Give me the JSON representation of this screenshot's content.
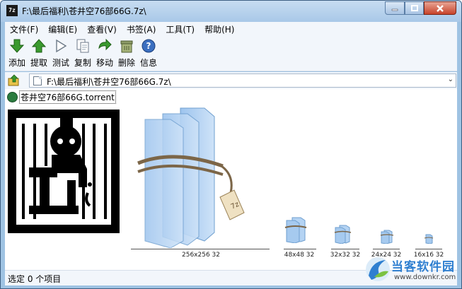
{
  "window": {
    "title": "F:\\最后福利\\苍井空76部66G.7z\\",
    "app_icon": "7z"
  },
  "menu": [
    "文件(F)",
    "编辑(E)",
    "查看(V)",
    "书签(A)",
    "工具(T)",
    "帮助(H)"
  ],
  "toolbar": [
    "添加",
    "提取",
    "测试",
    "复制",
    "移动",
    "删除",
    "信息"
  ],
  "address": {
    "path": "F:\\最后福利\\苍井空76部66G.7z\\"
  },
  "file": {
    "name": "苍井空76部66G.torrent"
  },
  "preview_sizes": [
    "256x256 32",
    "48x48 32",
    "32x32 32",
    "24x24 32",
    "16x16 32"
  ],
  "status": {
    "selected": "选定 0 个项目"
  },
  "watermark": {
    "title": "当客软件园",
    "url": "www.downkr.com"
  },
  "colors": {
    "accent": "#2f7fd0",
    "close_button": "#c7432b",
    "toolbar_green": "#3a9a2e"
  }
}
